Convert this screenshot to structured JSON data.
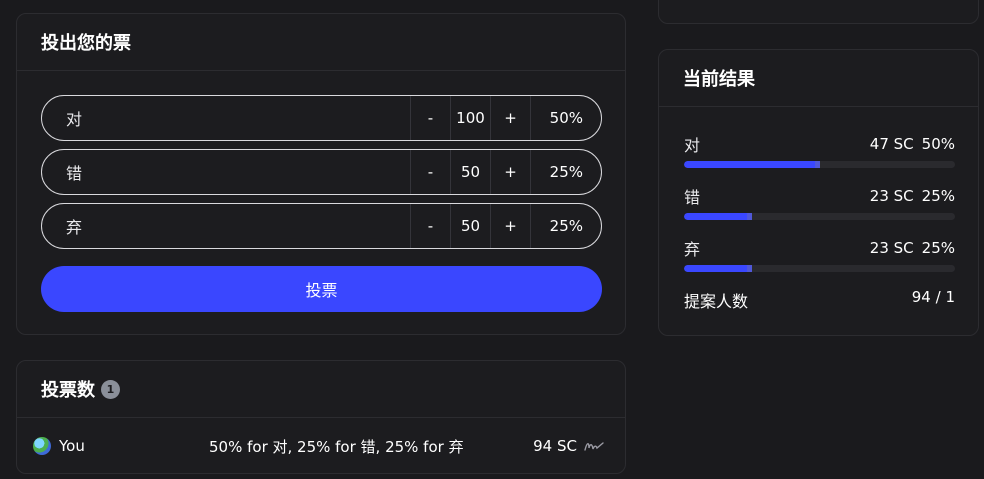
{
  "vote_card": {
    "title": "投出您的票",
    "options": [
      {
        "label": "对",
        "minus": "-",
        "amount": "100",
        "plus": "+",
        "percent": "50%"
      },
      {
        "label": "错",
        "minus": "-",
        "amount": "50",
        "plus": "+",
        "percent": "25%"
      },
      {
        "label": "弃",
        "minus": "-",
        "amount": "50",
        "plus": "+",
        "percent": "25%"
      }
    ],
    "submit_label": "投票"
  },
  "results_card": {
    "title": "当前结果",
    "results": [
      {
        "label": "对",
        "amount": "47 SC",
        "percent": "50%",
        "fill": 0.5
      },
      {
        "label": "错",
        "amount": "23 SC",
        "percent": "25%",
        "fill": 0.25
      },
      {
        "label": "弃",
        "amount": "23 SC",
        "percent": "25%",
        "fill": 0.25
      }
    ],
    "proposers_label": "提案人数",
    "proposers_value": "94 / 1"
  },
  "votes_card": {
    "title": "投票数",
    "count": "1",
    "entries": [
      {
        "voter": "You",
        "description": "50% for 对, 25% for 错, 25% for 弃",
        "total": "94 SC"
      }
    ]
  },
  "colors": {
    "accent": "#3a47ff",
    "background": "#1a1a1d",
    "card": "#1c1c1f",
    "border": "#2c2c30"
  },
  "icons": [
    "avatar",
    "signature-icon"
  ]
}
